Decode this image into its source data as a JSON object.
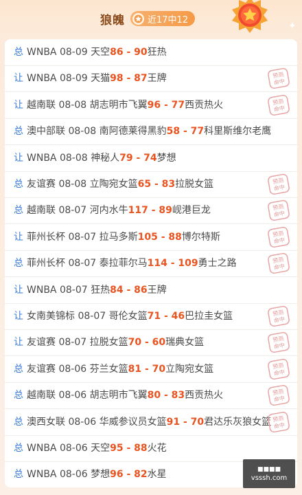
{
  "header": {
    "title": "狼魄",
    "streak": "近17中12",
    "colors": {
      "accent": "#f59a47",
      "score": "#e8531f",
      "tag": "#3a7bd5"
    }
  },
  "stamp_text": [
    "预测",
    "命中"
  ],
  "watermark": {
    "line1": "■■■■",
    "line2": "vsssh.com"
  },
  "rows": [
    {
      "tag": "总",
      "league": "WNBA",
      "date": "08-09",
      "home": "天空",
      "hs": "86",
      "sep": " - ",
      "as": "90",
      "away": "狂热",
      "hit": false
    },
    {
      "tag": "让",
      "league": "WNBA",
      "date": "08-09",
      "home": "天猫",
      "hs": "98",
      "sep": " - ",
      "as": "87",
      "away": "王牌",
      "hit": true
    },
    {
      "tag": "让",
      "league": "越南联",
      "date": "08-08",
      "home": "胡志明市飞翼",
      "hs": "96",
      "sep": " - ",
      "as": "77",
      "away": "西贡热火",
      "hit": true
    },
    {
      "tag": "总",
      "league": "澳中部联",
      "date": "08-08",
      "home": "南阿德莱得黑豹",
      "hs": "58",
      "sep": " - ",
      "as": "77",
      "away": "科里斯维尔老鹰",
      "hit": false
    },
    {
      "tag": "让",
      "league": "WNBA",
      "date": "08-08",
      "home": "神秘人",
      "hs": "79",
      "sep": " - ",
      "as": "74",
      "away": "梦想",
      "hit": false
    },
    {
      "tag": "总",
      "league": "友谊赛",
      "date": "08-08",
      "home": "立陶宛女篮",
      "hs": "65",
      "sep": " - ",
      "as": "83",
      "away": "拉脱女篮",
      "hit": true
    },
    {
      "tag": "总",
      "league": "越南联",
      "date": "08-07",
      "home": "河内水牛",
      "hs": "117",
      "sep": " - ",
      "as": "89",
      "away": "岘港巨龙",
      "hit": true
    },
    {
      "tag": "让",
      "league": "菲州长杯",
      "date": "08-07",
      "home": "拉马多斯",
      "hs": "105",
      "sep": " - ",
      "as": "88",
      "away": "博尔特斯",
      "hit": true
    },
    {
      "tag": "总",
      "league": "菲州长杯",
      "date": "08-07",
      "home": "泰拉菲尔马",
      "hs": "114",
      "sep": " - ",
      "as": "109",
      "away": "勇士之路",
      "hit": true
    },
    {
      "tag": "让",
      "league": "WNBA",
      "date": "08-07",
      "home": "狂热",
      "hs": "84",
      "sep": " - ",
      "as": "86",
      "away": "王牌",
      "hit": false
    },
    {
      "tag": "让",
      "league": "女南美锦标",
      "date": "08-07",
      "home": "哥伦女篮",
      "hs": "71",
      "sep": " - ",
      "as": "46",
      "away": "巴拉圭女篮",
      "hit": true
    },
    {
      "tag": "让",
      "league": "友谊赛",
      "date": "08-07",
      "home": "拉脱女篮",
      "hs": "70",
      "sep": " - ",
      "as": "60",
      "away": "瑞典女篮",
      "hit": true
    },
    {
      "tag": "总",
      "league": "友谊赛",
      "date": "08-06",
      "home": "芬兰女篮",
      "hs": "81",
      "sep": " - ",
      "as": "70",
      "away": "立陶宛女篮",
      "hit": true
    },
    {
      "tag": "总",
      "league": "越南联",
      "date": "08-06",
      "home": "胡志明市飞翼",
      "hs": "80",
      "sep": " - ",
      "as": "83",
      "away": "西贡热火",
      "hit": true
    },
    {
      "tag": "总",
      "league": "澳西女联",
      "date": "08-06",
      "home": "华威参议员女篮",
      "hs": "91",
      "sep": " - ",
      "as": "70",
      "away": "君达乐灰狼女篮",
      "hit": true
    },
    {
      "tag": "总",
      "league": "WNBA",
      "date": "08-06",
      "home": "天空",
      "hs": "95",
      "sep": " - ",
      "as": "88",
      "away": "火花",
      "hit": false
    },
    {
      "tag": "总",
      "league": "WNBA",
      "date": "08-06",
      "home": "梦想",
      "hs": "96",
      "sep": " - ",
      "as": "82",
      "away": "水星",
      "hit": false
    }
  ]
}
